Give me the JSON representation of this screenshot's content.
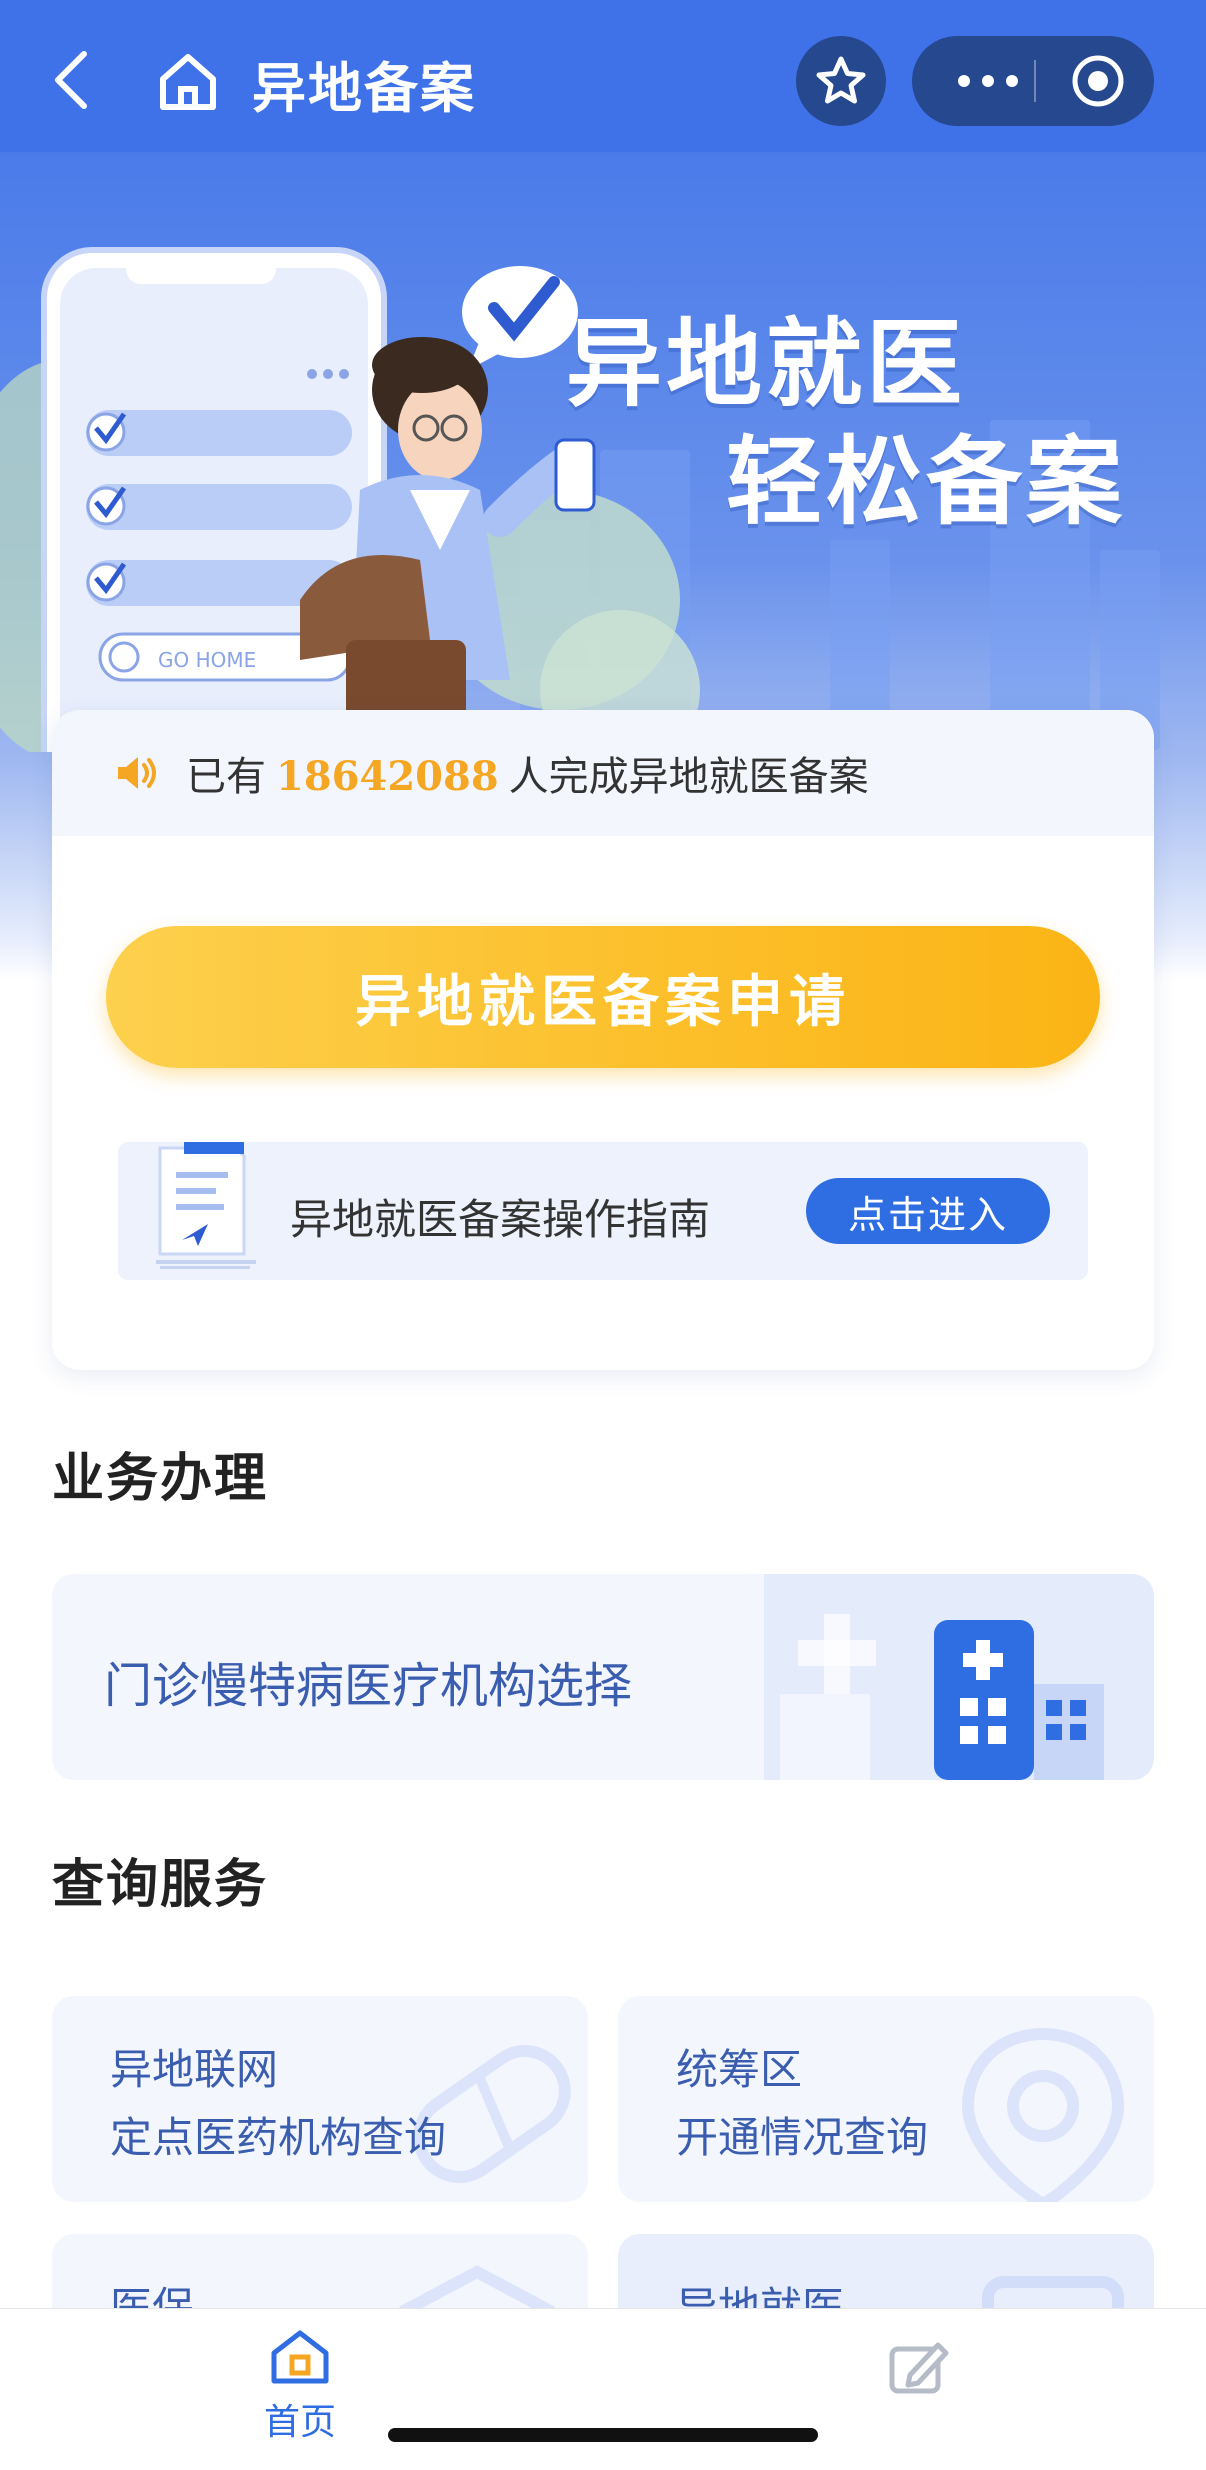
{
  "nav": {
    "title": "异地备案",
    "icons": [
      "chevron-left-icon",
      "home-icon",
      "star-icon",
      "more-icon",
      "target-icon"
    ]
  },
  "hero": {
    "slogan_line1": "异地就医",
    "slogan_line2": "轻松备案",
    "phone_button_text": "GO HOME"
  },
  "notice": {
    "prefix": "已有",
    "count": "18642088",
    "suffix": "人完成异地就医备案"
  },
  "apply_button": "异地就医备案申请",
  "guide": {
    "label": "异地就医备案操作指南",
    "button": "点击进入"
  },
  "business": {
    "title": "业务办理",
    "items": [
      {
        "label": "门诊慢特病医疗机构选择"
      }
    ]
  },
  "query": {
    "title": "查询服务",
    "items": [
      {
        "line1": "异地联网",
        "line2": "定点医药机构查询"
      },
      {
        "line1": "统筹区",
        "line2": "开通情况查询"
      },
      {
        "line1": "医保",
        "line2": ""
      },
      {
        "line1": "异地就医",
        "line2": ""
      }
    ]
  },
  "tabbar": {
    "items": [
      {
        "label": "首页",
        "active": true
      },
      {
        "label": "",
        "active": false
      }
    ]
  },
  "colors": {
    "primary_blue": "#3f72e8",
    "accent_yellow": "#fcc12e",
    "count_orange": "#f5a623",
    "link_blue": "#2f6de2"
  }
}
